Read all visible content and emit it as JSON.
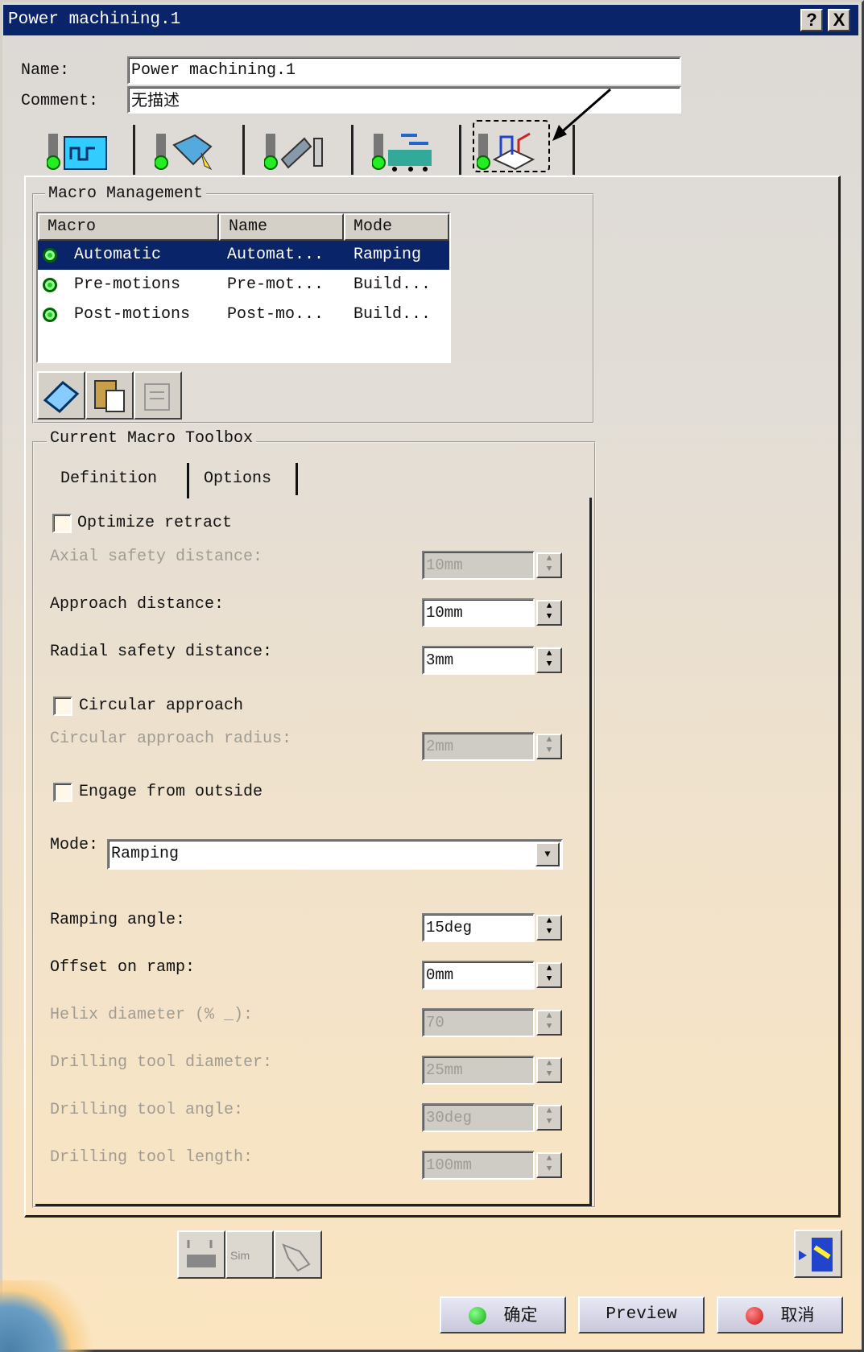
{
  "window": {
    "title": "Power machining.1",
    "help_label": "?",
    "close_label": "X"
  },
  "form": {
    "name_label": "Name:",
    "name_value": "Power machining.1",
    "comment_label": "Comment:",
    "comment_value": "无描述"
  },
  "tabs": [
    {
      "icon": "geometry-tab-icon"
    },
    {
      "icon": "strategy-tab-icon"
    },
    {
      "icon": "tool-tab-icon"
    },
    {
      "icon": "feeds-speeds-tab-icon"
    },
    {
      "icon": "macro-tab-icon",
      "selected": true
    }
  ],
  "macro_management": {
    "title": "Macro Management",
    "columns": [
      "Macro",
      "Name",
      "Mode"
    ],
    "rows": [
      {
        "macro": "Automatic",
        "name": "Automat...",
        "mode": "Ramping",
        "selected": true
      },
      {
        "macro": "Pre-motions",
        "name": "Pre-mot...",
        "mode": "Build..."
      },
      {
        "macro": "Post-motions",
        "name": "Post-mo...",
        "mode": "Build..."
      }
    ]
  },
  "toolbox": {
    "title": "Current Macro Toolbox",
    "tabs": [
      "Definition",
      "Options"
    ],
    "optimize_retract": "Optimize retract",
    "axial_label": "Axial safety distance:",
    "axial_value": "10mm",
    "approach_label": "Approach distance:",
    "approach_value": "10mm",
    "radial_label": "Radial safety distance:",
    "radial_value": "3mm",
    "circular_approach": "Circular approach",
    "circ_radius_label": "Circular approach radius:",
    "circ_radius_value": "2mm",
    "engage_outside": "Engage from outside",
    "mode_label": "Mode:",
    "mode_value": "Ramping",
    "ramp_angle_label": "Ramping angle:",
    "ramp_angle_value": "15deg",
    "offset_label": "Offset on ramp:",
    "offset_value": "0mm",
    "helix_label": "Helix diameter (% _):",
    "helix_value": "70",
    "drill_diam_label": "Drilling tool diameter:",
    "drill_diam_value": "25mm",
    "drill_angle_label": "Drilling tool angle:",
    "drill_angle_value": "30deg",
    "drill_len_label": "Drilling tool length:",
    "drill_len_value": "100mm"
  },
  "footer": {
    "ok_label": "确定",
    "preview_label": "Preview",
    "cancel_label": "取消"
  },
  "colors": {
    "titlebar": "#0a246a",
    "selection": "#0a246a"
  }
}
